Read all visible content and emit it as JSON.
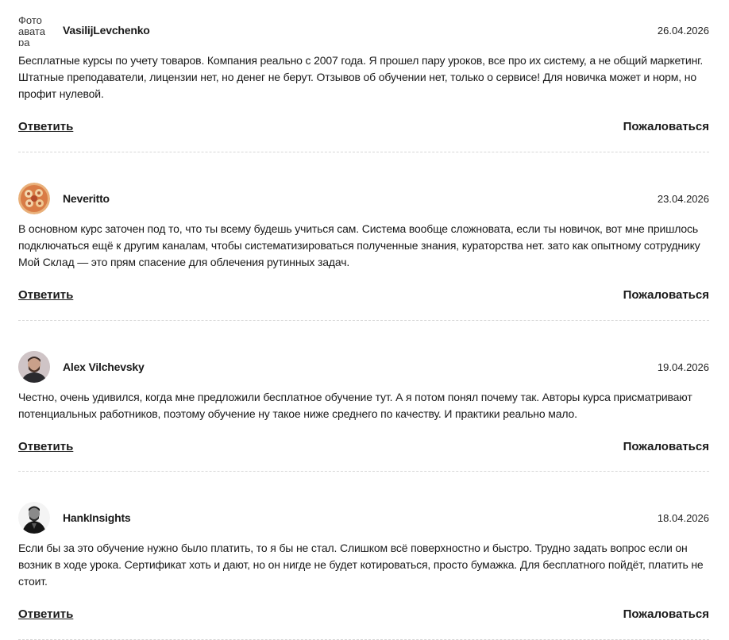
{
  "reviews": [
    {
      "avatar_alt": "Фото аватара",
      "author": "VasilijLevchenko",
      "date": "26.04.2026",
      "text": "Бесплатные курсы по учету товаров. Компания реально с 2007 года. Я прошел пару уроков, все про их систему, а не общий маркетинг. Штатные преподаватели, лицензии нет, но денег не берут. Отзывов об обучении нет, только о сервисе! Для новичка может и норм, но профит нулевой.",
      "reply_label": "Ответить",
      "complain_label": "Пожаловаться"
    },
    {
      "author": "Neveritto",
      "date": "23.04.2026",
      "text": "В основном курс заточен под то, что ты всему будешь учиться сам. Система вообще сложновата, если ты новичок, вот мне пришлось подключаться ещё к другим каналам, чтобы систематизироваться полученные знания, кураторства нет. зато как опытному сотруднику Мой Склад — это прям спасение для облечения рутинных задач.",
      "reply_label": "Ответить",
      "complain_label": "Пожаловаться"
    },
    {
      "author": "Alex Vilchevsky",
      "date": "19.04.2026",
      "text": "Честно, очень удивился, когда мне предложили бесплатное обучение тут. А я потом понял почему так. Авторы курса присматривают потенциальных работников, поэтому обучение ну такое ниже среднего по качеству. И практики реально мало.",
      "reply_label": "Ответить",
      "complain_label": "Пожаловаться"
    },
    {
      "author": "HankInsights",
      "date": "18.04.2026",
      "text": "Если бы за это обучение нужно было платить, то я бы не стал. Слишком всё поверхностно и быстро. Трудно задать вопрос если он возник в ходе урока. Сертификат хоть и дают, но он нигде не будет котироваться, просто бумажка. Для бесплатного пойдёт, платить не стоит.",
      "reply_label": "Ответить",
      "complain_label": "Пожаловаться"
    }
  ]
}
